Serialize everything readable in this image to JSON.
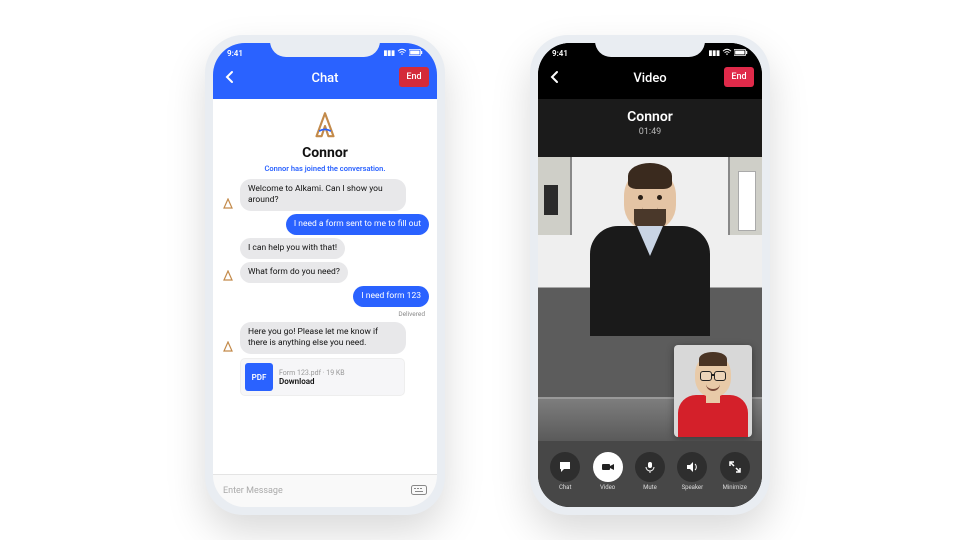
{
  "chat": {
    "status_time": "9:41",
    "header_title": "Chat",
    "end_label": "End",
    "contact_name": "Connor",
    "joined_text": "Connor has joined the conversation.",
    "messages": {
      "m1": "Welcome to Alkami. Can I show you around?",
      "m2": "I need a form sent to me to fill out",
      "m3": "I can help you with that!",
      "m4": "What form do you need?",
      "m5": "I need form 123",
      "delivered": "Delivered",
      "m6": "Here you go! Please let me know if there is anything else you need."
    },
    "attachment": {
      "badge": "PDF",
      "meta": "Form 123.pdf · 19 KB",
      "download": "Download"
    },
    "input_placeholder": "Enter Message"
  },
  "video": {
    "status_time": "9:41",
    "header_title": "Video",
    "end_label": "End",
    "call_name": "Connor",
    "call_duration": "01:49",
    "controls": {
      "chat": "Chat",
      "video": "Video",
      "mute": "Mute",
      "speaker": "Speaker",
      "minimize": "Minimize"
    }
  }
}
